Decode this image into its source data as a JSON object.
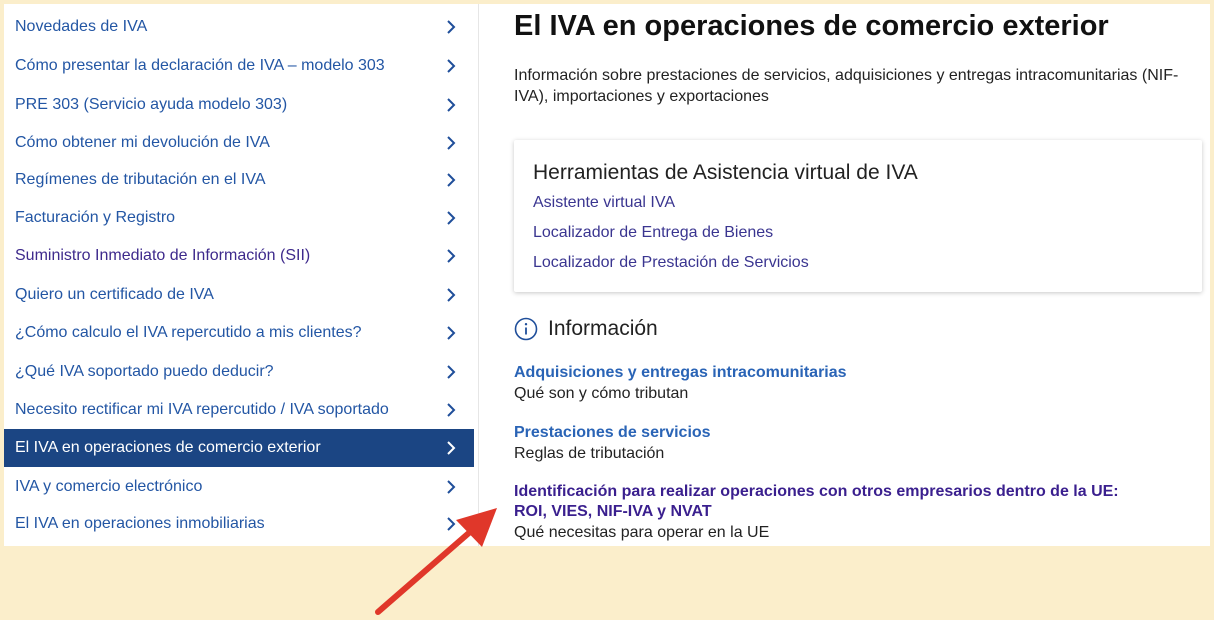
{
  "sidebar": {
    "items": [
      {
        "label": "Novedades de IVA"
      },
      {
        "label": "Cómo presentar la declaración de IVA – modelo 303"
      },
      {
        "label": "PRE 303 (Servicio ayuda modelo 303)"
      },
      {
        "label": "Cómo obtener mi devolución de IVA"
      },
      {
        "label": "Regímenes de tributación en el IVA"
      },
      {
        "label": "Facturación y Registro"
      },
      {
        "label": "Suministro Inmediato de Información (SII)"
      },
      {
        "label": "Quiero un certificado de IVA"
      },
      {
        "label": "¿Cómo calculo el IVA repercutido a mis clientes?"
      },
      {
        "label": "¿Qué IVA soportado puedo deducir?"
      },
      {
        "label": "Necesito rectificar mi IVA repercutido / IVA soportado"
      },
      {
        "label": "El IVA en operaciones de comercio exterior"
      },
      {
        "label": "IVA y comercio electrónico"
      },
      {
        "label": "El IVA en operaciones inmobiliarias"
      }
    ],
    "active_index": 11
  },
  "main": {
    "title": "El IVA en operaciones de comercio exterior",
    "description": "Información sobre prestaciones de servicios, adquisiciones y entregas intracomunitarias (NIF-IVA), importaciones y exportaciones",
    "tools_card": {
      "title": "Herramientas de Asistencia virtual de IVA",
      "links": [
        "Asistente virtual IVA",
        "Localizador de Entrega de Bienes",
        "Localizador de Prestación de Servicios"
      ]
    },
    "info": {
      "title": "Información",
      "items": [
        {
          "title": "Adquisiciones y entregas intracomunitarias",
          "desc": "Qué son y cómo tributan"
        },
        {
          "title": "Prestaciones de servicios",
          "desc": "Reglas de tributación"
        },
        {
          "title_line1": "Identificación para realizar operaciones con otros empresarios dentro de la UE:",
          "title_line2": "ROI, VIES, NIF-IVA y NVAT",
          "desc": "Qué necesitas para operar en la UE"
        }
      ]
    }
  },
  "colors": {
    "background": "#fbeecb",
    "active_item": "#1b4583",
    "link": "#2356a4",
    "visited_link": "#3a1f8e",
    "arrow": "#e0372a"
  },
  "icons": {
    "chevron": "chevron-right-icon",
    "info": "info-circle-icon",
    "annotation": "red-arrow-annotation"
  }
}
